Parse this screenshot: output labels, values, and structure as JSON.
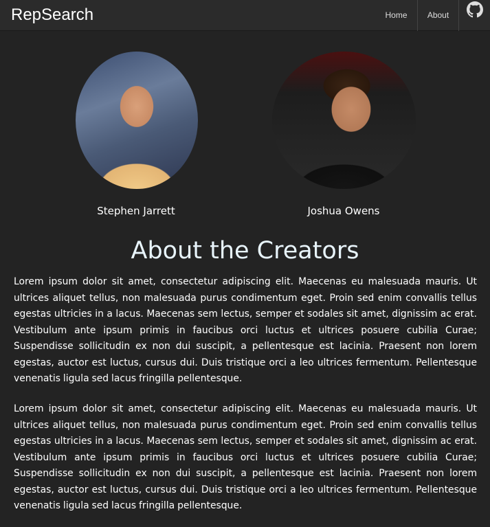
{
  "navbar": {
    "brand": "RepSearch",
    "links": [
      {
        "label": "Home"
      },
      {
        "label": "About"
      }
    ],
    "github_icon": "github-icon"
  },
  "creators": [
    {
      "name": "Stephen Jarrett"
    },
    {
      "name": "Joshua Owens"
    }
  ],
  "page": {
    "title": "About the Creators",
    "paragraphs": [
      "Lorem ipsum dolor sit amet, consectetur adipiscing elit. Maecenas eu malesuada mauris. Ut ultrices aliquet tellus, non malesuada purus condimentum eget. Proin sed enim convallis tellus egestas ultricies in a lacus. Maecenas sem lectus, semper et sodales sit amet, dignissim ac erat. Vestibulum ante ipsum primis in faucibus orci luctus et ultrices posuere cubilia Curae; Suspendisse sollicitudin ex non dui suscipit, a pellentesque est lacinia. Praesent non lorem egestas, auctor est luctus, cursus dui. Duis tristique orci a leo ultrices fermentum. Pellentesque venenatis ligula sed lacus fringilla pellentesque.",
      "Lorem ipsum dolor sit amet, consectetur adipiscing elit. Maecenas eu malesuada mauris. Ut ultrices aliquet tellus, non malesuada purus condimentum eget. Proin sed enim convallis tellus egestas ultricies in a lacus. Maecenas sem lectus, semper et sodales sit amet, dignissim ac erat. Vestibulum ante ipsum primis in faucibus orci luctus et ultrices posuere cubilia Curae; Suspendisse sollicitudin ex non dui suscipit, a pellentesque est lacinia. Praesent non lorem egestas, auctor est luctus, cursus dui. Duis tristique orci a leo ultrices fermentum. Pellentesque venenatis ligula sed lacus fringilla pellentesque."
    ]
  },
  "colors": {
    "navbar_bg": "#2b2b2b",
    "page_bg": "#232323",
    "title_color": "#e8f4fb",
    "text_color": "#ffffff"
  }
}
